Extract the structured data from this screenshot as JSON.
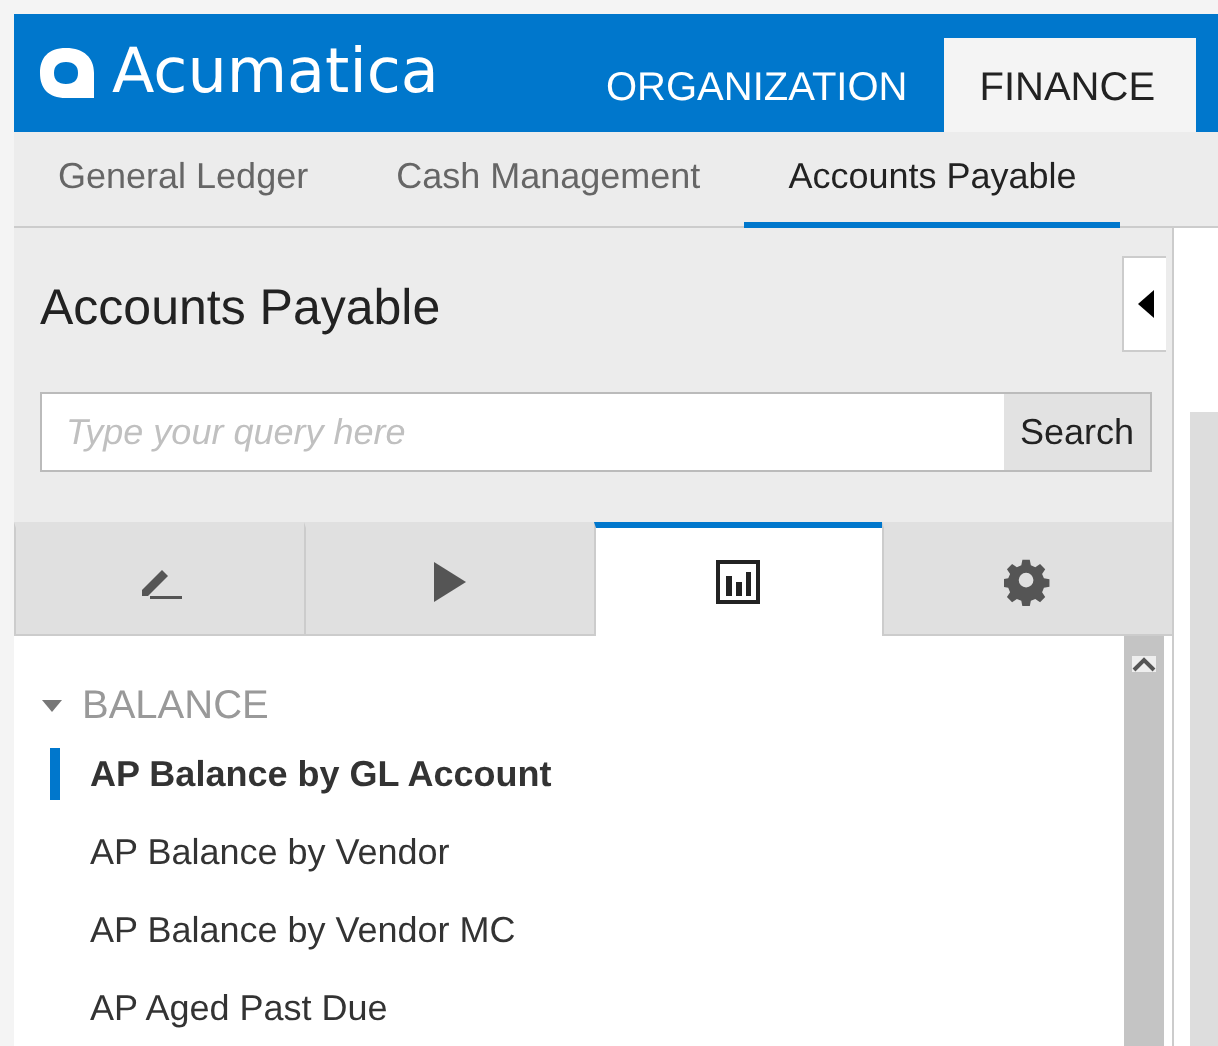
{
  "header": {
    "logo": "Acumatica",
    "menu": [
      {
        "label": "ORGANIZATION",
        "selected": false
      },
      {
        "label": "FINANCE",
        "selected": true
      }
    ]
  },
  "sub_nav": [
    {
      "label": "General Ledger",
      "selected": false
    },
    {
      "label": "Cash Management",
      "selected": false
    },
    {
      "label": "Accounts Payable",
      "selected": true
    }
  ],
  "panel": {
    "title": "Accounts Payable",
    "search": {
      "placeholder": "Type your query here",
      "button": "Search"
    },
    "tool_tabs": [
      {
        "kind": "edit",
        "selected": false
      },
      {
        "kind": "run",
        "selected": false
      },
      {
        "kind": "reports",
        "selected": true
      },
      {
        "kind": "settings",
        "selected": false
      }
    ],
    "groups": [
      {
        "label": "BALANCE",
        "expanded": true,
        "children": [
          {
            "label": "AP Balance by GL Account",
            "selected": true
          },
          {
            "label": "AP Balance by Vendor",
            "selected": false
          },
          {
            "label": "AP Balance by Vendor MC",
            "selected": false
          },
          {
            "label": "AP Aged Past Due",
            "selected": false
          }
        ]
      }
    ]
  }
}
